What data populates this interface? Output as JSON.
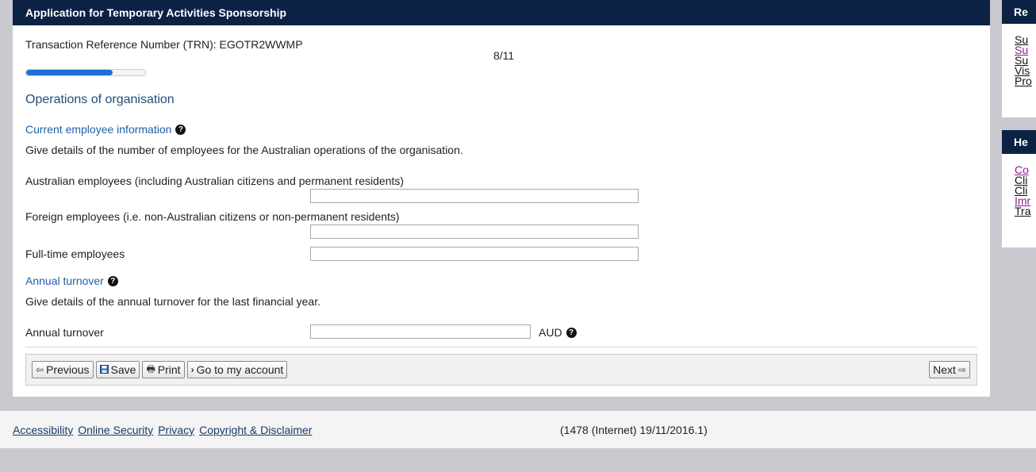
{
  "form": {
    "header_title": "Application for Temporary Activities Sponsorship",
    "trn_text": "Transaction Reference Number (TRN): EGOTR2WWMP",
    "page_count": "8/11",
    "progress_fraction": 0.727,
    "section_title": "Operations of organisation",
    "employee_info": {
      "heading": "Current employee information",
      "description": "Give details of the number of employees for the Australian operations of the organisation.",
      "fields": [
        {
          "label": "Australian employees (including Australian citizens and permanent residents)",
          "value": ""
        },
        {
          "label": "Foreign employees (i.e. non-Australian citizens or non-permanent residents)",
          "value": ""
        },
        {
          "label": "Full-time employees",
          "value": ""
        }
      ]
    },
    "turnover": {
      "heading": "Annual turnover",
      "description": "Give details of the annual turnover for the last financial year.",
      "field_label": "Annual turnover",
      "value": "",
      "unit": "AUD"
    }
  },
  "toolbar": {
    "previous_label": "Previous",
    "save_label": "Save",
    "print_label": "Print",
    "account_label": "Go to my account",
    "next_label": "Next"
  },
  "sidebar": {
    "box1": {
      "title": "Re",
      "links": [
        "Su",
        "Su",
        "Su",
        "Vis",
        "Pro"
      ]
    },
    "box2": {
      "title": "He",
      "links": [
        "Co",
        "Cli",
        "Cli",
        "Imr",
        "Tra"
      ]
    }
  },
  "footer": {
    "links": [
      "Accessibility",
      "Online Security",
      "Privacy",
      "Copyright & Disclaimer"
    ],
    "version": "(1478 (Internet) 19/11/2016.1)"
  },
  "colors": {
    "header_bg": "#0b2244",
    "progress": "#1f6fd6",
    "heading_blue": "#1f5fa6",
    "visited_link": "#8a1c8a"
  },
  "icons": [
    "help-icon",
    "arrow-left-icon",
    "floppy-disk-icon",
    "printer-icon",
    "chevron-right-icon",
    "arrow-right-icon"
  ]
}
